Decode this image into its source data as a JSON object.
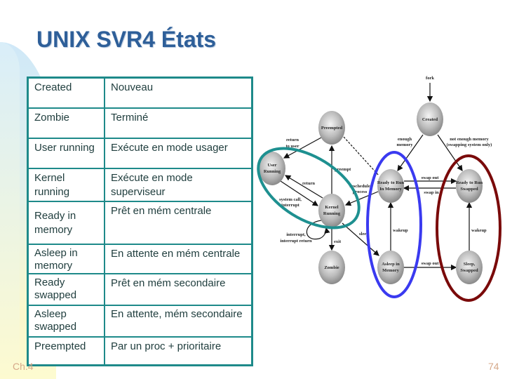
{
  "slide": {
    "title": "UNIX SVR4 États",
    "footer_left": "Ch.4",
    "page_number": "74"
  },
  "table": {
    "rows": [
      {
        "state": "Created",
        "meaning": "Nouveau"
      },
      {
        "state": "Zombie",
        "meaning": "Terminé"
      },
      {
        "state": "User running",
        "meaning": "Exécute en mode usager"
      },
      {
        "state": "Kernel running",
        "meaning": "Exécute en mode superviseur"
      },
      {
        "state": "Ready in memory",
        "meaning": "Prêt en mém centrale"
      },
      {
        "state": "Asleep in memory",
        "meaning": "En attente en mém centrale"
      },
      {
        "state": "Ready swapped",
        "meaning": "Prêt en mém secondaire"
      },
      {
        "state": "Asleep swapped",
        "meaning": "En attente, mém secondaire"
      },
      {
        "state": "Preempted",
        "meaning": "Par un proc + prioritaire"
      }
    ]
  },
  "diagram": {
    "nodes": {
      "preempted": [
        "Preempted"
      ],
      "created": [
        "Created"
      ],
      "user_running": [
        "User",
        "Running"
      ],
      "kernel_running": [
        "Kernel",
        "Running"
      ],
      "ready_memory": [
        "Ready to Run",
        "In Memory"
      ],
      "ready_swapped": [
        "Ready to Run",
        "Swapped"
      ],
      "zombie": [
        "Zombie"
      ],
      "asleep_memory": [
        "Asleep in",
        "Memory"
      ],
      "sleep_swapped": [
        "Sleep,",
        "Swapped"
      ]
    },
    "edge_labels": {
      "fork": "fork",
      "return_to_user_1": "return",
      "return_to_user_2": "to user",
      "preempt": "preempt",
      "return": "return",
      "reschedule_1": "reschedule",
      "reschedule_2": "process",
      "syscall_1": "system call,",
      "syscall_2": "interrupt",
      "interrupt_1": "interrupt,",
      "interrupt_2": "interrupt return",
      "exit": "exit",
      "sleep": "sleep",
      "enough_1": "enough",
      "enough_2": "memory",
      "not_enough_1": "not enough memory",
      "not_enough_2": "(swapping system only)",
      "swap_out_1": "swap out",
      "swap_in": "swap in",
      "wakeup_1": "wakeup",
      "wakeup_2": "wakeup",
      "swap_out_2": "swap out"
    },
    "highlight_colors": {
      "running": "#1e9090",
      "memory": "#3a3af0",
      "swapped": "#7a0a0a"
    }
  }
}
